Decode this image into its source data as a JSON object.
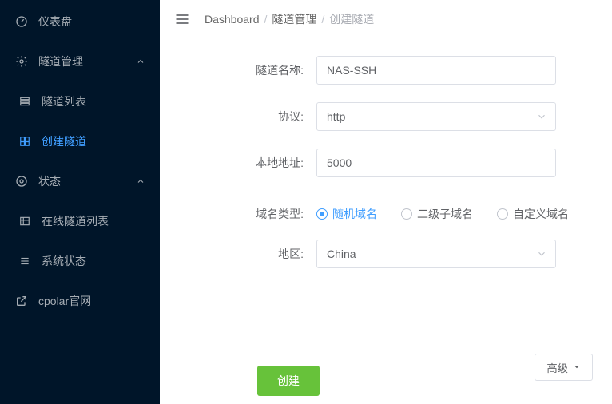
{
  "sidebar": {
    "items": [
      {
        "label": "仪表盘"
      },
      {
        "label": "隧道管理"
      },
      {
        "label": "隧道列表"
      },
      {
        "label": "创建隧道"
      },
      {
        "label": "状态"
      },
      {
        "label": "在线隧道列表"
      },
      {
        "label": "系统状态"
      },
      {
        "label": "cpolar官网"
      }
    ]
  },
  "breadcrumb": [
    "Dashboard",
    "隧道管理",
    "创建隧道"
  ],
  "form": {
    "tunnel_name": {
      "label": "隧道名称",
      "value": "NAS-SSH"
    },
    "protocol": {
      "label": "协议",
      "value": "http"
    },
    "local_addr": {
      "label": "本地地址",
      "value": "5000"
    },
    "domain_type": {
      "label": "域名类型",
      "options": [
        "随机域名",
        "二级子域名",
        "自定义域名"
      ],
      "selected": 0
    },
    "region": {
      "label": "地区",
      "value": "China"
    },
    "advanced_label": "高级",
    "create_label": "创建"
  },
  "colors": {
    "accent": "#409eff",
    "success": "#67c23a",
    "sidebar_bg": "#001529"
  }
}
